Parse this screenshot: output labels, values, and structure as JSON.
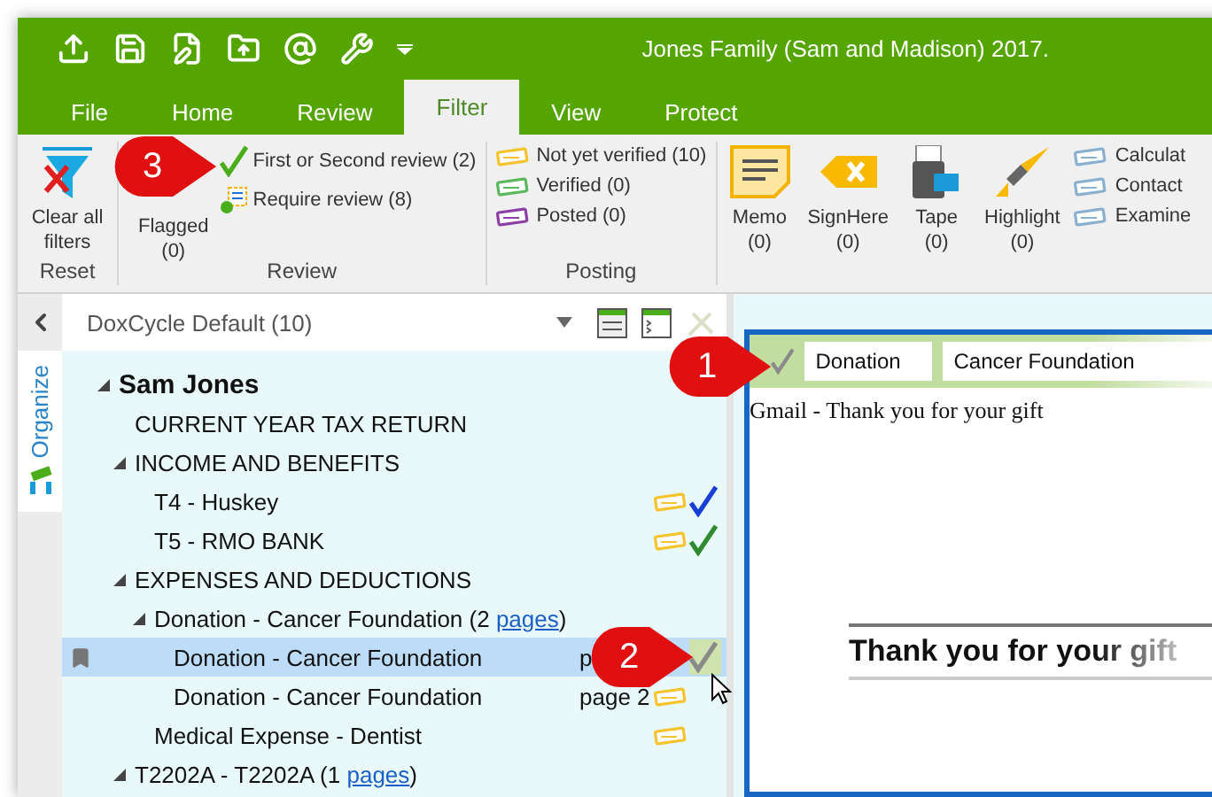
{
  "window": {
    "title": "Jones Family (Sam and Madison) 2017."
  },
  "tabs": [
    {
      "label": "File",
      "selected": false
    },
    {
      "label": "Home",
      "selected": false
    },
    {
      "label": "Review",
      "selected": false
    },
    {
      "label": "Filter",
      "selected": true
    },
    {
      "label": "View",
      "selected": false
    },
    {
      "label": "Protect",
      "selected": false
    }
  ],
  "ribbon": {
    "reset": {
      "label": "Reset",
      "button": "Clear all filters"
    },
    "review": {
      "label": "Review",
      "flagged": {
        "label": "Flagged",
        "count": "(0)"
      },
      "items": [
        {
          "kind": "check",
          "label": "First or Second review (2)"
        },
        {
          "kind": "require",
          "label": "Require review (8)"
        }
      ]
    },
    "posting": {
      "label": "Posting",
      "items": [
        {
          "label": "Not yet verified (10)",
          "color": "#f5c32c"
        },
        {
          "label": "Verified (0)",
          "color": "#5cb85c"
        },
        {
          "label": "Posted (0)",
          "color": "#8e3fa6"
        }
      ]
    },
    "markups": [
      {
        "kind": "memo",
        "label": "Memo",
        "count": "(0)"
      },
      {
        "kind": "signhere",
        "label": "SignHere",
        "count": "(0)"
      },
      {
        "kind": "tape",
        "label": "Tape",
        "count": "(0)"
      },
      {
        "kind": "highlight",
        "label": "Highlight",
        "count": "(0)"
      }
    ],
    "annotations": [
      {
        "label": "Calculat"
      },
      {
        "label": "Contact"
      },
      {
        "label": "Examine"
      }
    ]
  },
  "panel": {
    "view_select": "DoxCycle Default (10)",
    "side_tab": "Organize"
  },
  "tree": [
    {
      "kind": "client",
      "label": "Sam Jones",
      "expanded": true,
      "selected": false,
      "children": [
        {
          "label": "CURRENT YEAR TAX RETURN",
          "selected": false
        },
        {
          "label": "INCOME AND BENEFITS",
          "expanded": true,
          "selected": false,
          "children": [
            {
              "label": "T4 - Huskey",
              "selected": false,
              "verify": true,
              "color": "#1a3fd6"
            },
            {
              "label": "T5 - RMO BANK",
              "selected": false,
              "verify": true,
              "color": "#2e8b2e"
            }
          ]
        },
        {
          "label": "EXPENSES AND DEDUCTIONS",
          "expanded": true,
          "selected": false,
          "children": [
            {
              "label": "Donation - Cancer Foundation (2 ",
              "link": "pages",
              "suffix": ")",
              "expanded": true,
              "selected": false,
              "children": [
                {
                  "label": "Donation - Cancer Foundation",
                  "page": "p",
                  "selected": true,
                  "color": "#8a8a8a"
                },
                {
                  "label": "Donation - Cancer Foundation",
                  "page": "page 2",
                  "selected": false,
                  "verify": true
                }
              ]
            },
            {
              "label": "Medical Expense - Dentist",
              "selected": false,
              "verify": true
            }
          ]
        },
        {
          "label": "T2202A - T2202A (1 ",
          "link": "pages",
          "suffix": ")",
          "expanded": true,
          "selected": false
        }
      ]
    }
  ],
  "document": {
    "checked": true,
    "category": "Donation",
    "payee": "Cancer Foundation",
    "subject": "Gmail - Thank you for your gift",
    "heading": "Thank you for your gift"
  },
  "callouts": [
    {
      "label": "3"
    },
    {
      "label": "1"
    },
    {
      "label": "2"
    }
  ]
}
